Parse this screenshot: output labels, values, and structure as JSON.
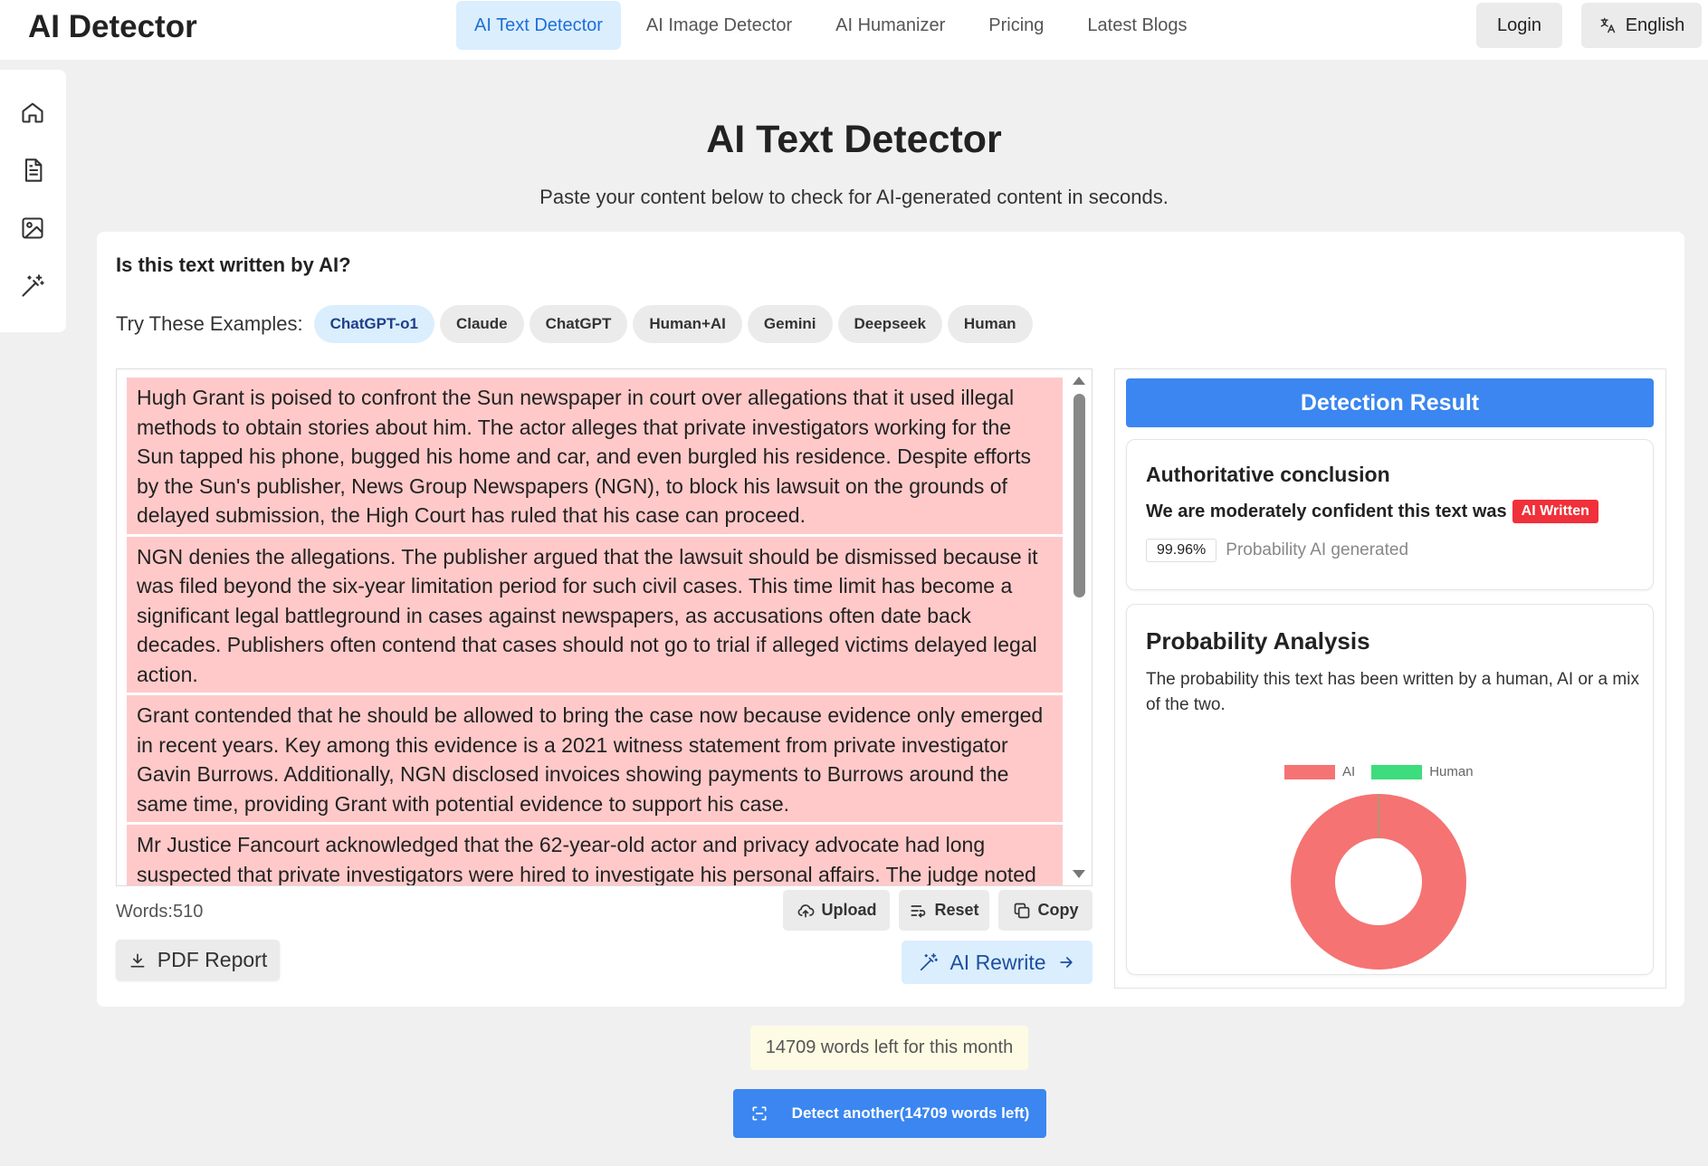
{
  "header": {
    "logo": "AI Detector",
    "nav": [
      {
        "label": "AI Text Detector",
        "active": true
      },
      {
        "label": "AI Image Detector",
        "active": false
      },
      {
        "label": "AI Humanizer",
        "active": false
      },
      {
        "label": "Pricing",
        "active": false
      },
      {
        "label": "Latest Blogs",
        "active": false
      }
    ],
    "login": "Login",
    "language": "English"
  },
  "sidebar": {
    "icons": [
      "home-icon",
      "document-icon",
      "image-icon",
      "magic-wand-icon"
    ]
  },
  "page": {
    "title": "AI Text Detector",
    "subtitle": "Paste your content below to check for AI-generated content in seconds."
  },
  "card": {
    "question": "Is this text written by AI?",
    "examples_label": "Try These Examples:",
    "examples": [
      "ChatGPT-o1",
      "Claude",
      "ChatGPT",
      "Human+AI",
      "Gemini",
      "Deepseek",
      "Human"
    ],
    "active_example": "ChatGPT-o1",
    "paragraphs": [
      "Hugh Grant is poised to confront the Sun newspaper in court over allegations that it used illegal methods to obtain stories about him. The actor alleges that private investigators working for the Sun tapped his phone, bugged his home and car, and even burgled his residence. Despite efforts by the Sun's publisher, News Group Newspapers (NGN), to block his lawsuit on the grounds of delayed submission, the High Court has ruled that his case can proceed.",
      "NGN denies the allegations. The publisher argued that the lawsuit should be dismissed because it was filed beyond the six-year limitation period for such civil cases. This time limit has become a significant legal battleground in cases against newspapers, as accusations often date back decades. Publishers often contend that cases should not go to trial if alleged victims delayed legal action.",
      "Grant contended that he should be allowed to bring the case now because evidence only emerged in recent years. Key among this evidence is a 2021 witness statement from private investigator Gavin Burrows. Additionally, NGN disclosed invoices showing payments to Burrows around the same time, providing Grant with potential evidence to support his case.",
      "Mr Justice Fancourt acknowledged that the 62-year-old actor and privacy advocate had long suspected that private investigators were hired to investigate his personal affairs. The judge noted there is a realistic chance that Grant will establish at trial that, before seeing the 2021 evidence, he"
    ],
    "words": "Words:510",
    "upload": "Upload",
    "reset": "Reset",
    "copy": "Copy",
    "pdf_report": "PDF Report",
    "ai_rewrite": "AI Rewrite"
  },
  "result": {
    "header": "Detection Result",
    "conclusion_title": "Authoritative conclusion",
    "conclusion_text": "We are moderately confident this text was",
    "badge": "AI Written",
    "probability": "99.96%",
    "probability_label": "Probability AI generated",
    "analysis_title": "Probability Analysis",
    "analysis_desc": "The probability this text has been written by a human, AI or a mix of the two."
  },
  "chart_data": {
    "type": "pie",
    "labels": [
      "AI",
      "Human"
    ],
    "values": [
      99.96,
      0.04
    ],
    "colors": [
      "#f57373",
      "#3ddc7c"
    ],
    "legend": "top"
  },
  "footer": {
    "quota": "14709 words left for this month",
    "detect_another": "Detect another(14709 words left)"
  },
  "colors": {
    "accent": "#3b86f0",
    "highlight": "#ffc9c9",
    "ai_badge": "#f0303a"
  }
}
